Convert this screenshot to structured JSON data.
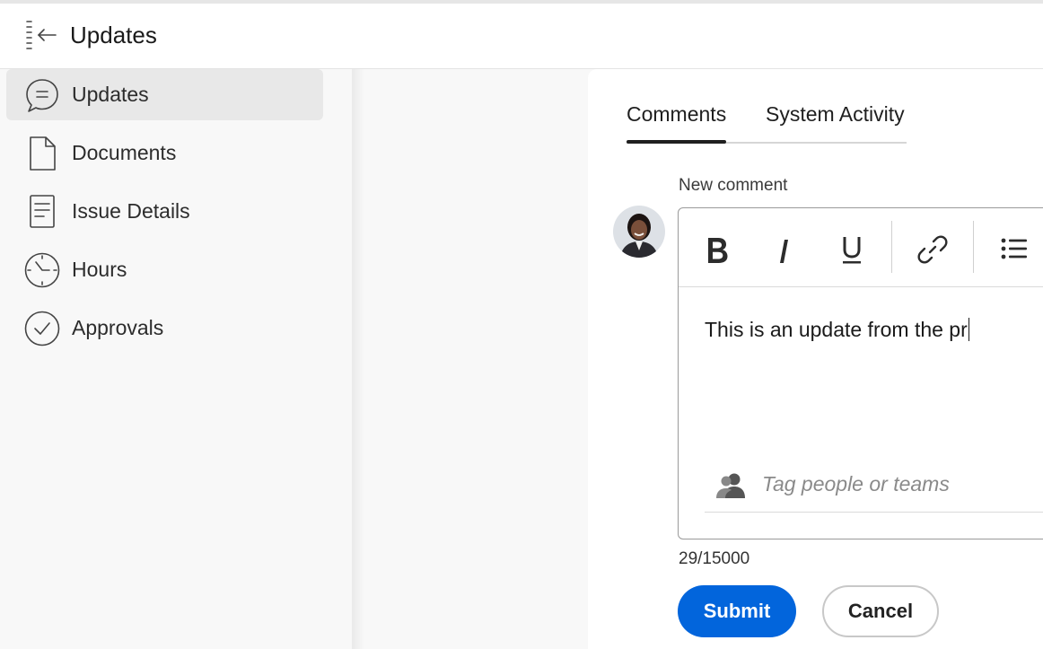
{
  "header": {
    "title": "Updates",
    "collapse_icon": "collapse-panel-icon"
  },
  "sidebar": {
    "items": [
      {
        "label": "Updates",
        "icon": "speech-bubble-icon",
        "active": true
      },
      {
        "label": "Documents",
        "icon": "document-icon",
        "active": false
      },
      {
        "label": "Issue Details",
        "icon": "details-icon",
        "active": false
      },
      {
        "label": "Hours",
        "icon": "clock-icon",
        "active": false
      },
      {
        "label": "Approvals",
        "icon": "checkmark-circle-icon",
        "active": false
      }
    ]
  },
  "tabs": [
    {
      "label": "Comments",
      "active": true
    },
    {
      "label": "System Activity",
      "active": false
    }
  ],
  "comment": {
    "label": "New comment",
    "text": "This is an update from the pr",
    "tag_placeholder": "Tag people or teams",
    "char_count": "29/15000"
  },
  "toolbar": {
    "buttons": [
      "bold-icon",
      "italic-icon",
      "underline-icon",
      "link-icon",
      "bullet-list-icon"
    ]
  },
  "actions": {
    "submit_label": "Submit",
    "cancel_label": "Cancel"
  },
  "colors": {
    "accent": "#0265dc",
    "sidebar_active": "#e8e8e8"
  }
}
